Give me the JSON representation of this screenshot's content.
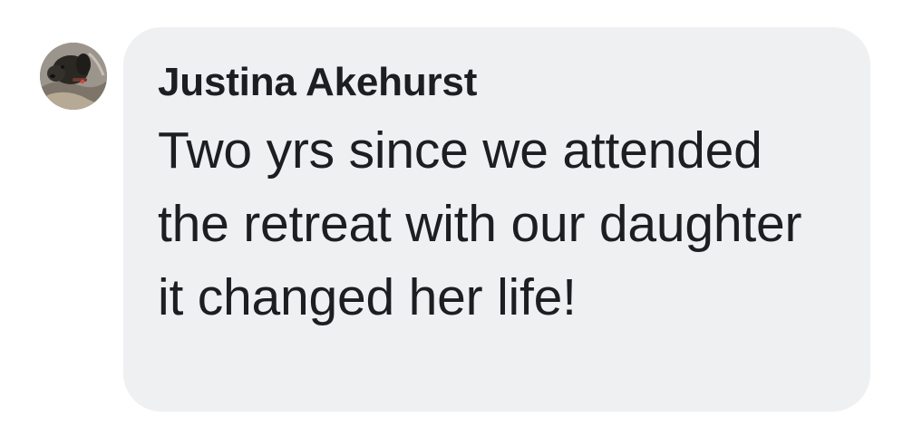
{
  "comment": {
    "author_name": "Justina Akehurst",
    "text": "Two yrs since we attended the retreat with our daughter it changed her life!",
    "avatar_icon": "dog-profile-photo",
    "bubble_color": "#eff0f2",
    "text_color": "#1c1e21"
  }
}
